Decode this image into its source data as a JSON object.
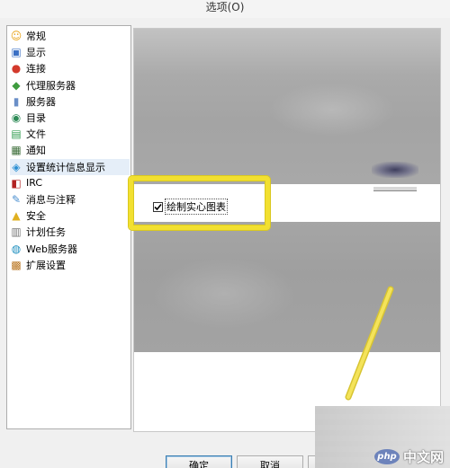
{
  "window": {
    "title": "选项(O)"
  },
  "sidebar": {
    "items": [
      {
        "label": "常规",
        "icon": "general-icon",
        "color": "#e8a317"
      },
      {
        "label": "显示",
        "icon": "display-icon",
        "color": "#3a6fc4"
      },
      {
        "label": "连接",
        "icon": "connection-icon",
        "color": "#d33a2c"
      },
      {
        "label": "代理服务器",
        "icon": "proxy-icon",
        "color": "#3f9c3f"
      },
      {
        "label": "服务器",
        "icon": "server-icon",
        "color": "#6a8fc7"
      },
      {
        "label": "目录",
        "icon": "directory-icon",
        "color": "#2e8b57"
      },
      {
        "label": "文件",
        "icon": "file-icon",
        "color": "#2f9b4e"
      },
      {
        "label": "通知",
        "icon": "notify-icon",
        "color": "#3d6e3a"
      },
      {
        "label": "设置统计信息显示",
        "icon": "statistics-icon",
        "color": "#2a8fd4",
        "selected": true
      },
      {
        "label": "IRC",
        "icon": "irc-icon",
        "color": "#b22222"
      },
      {
        "label": "消息与注释",
        "icon": "message-icon",
        "color": "#4a8fd0"
      },
      {
        "label": "安全",
        "icon": "security-icon",
        "color": "#e0b020"
      },
      {
        "label": "计划任务",
        "icon": "schedule-icon",
        "color": "#777777"
      },
      {
        "label": "Web服务器",
        "icon": "web-server-icon",
        "color": "#1f8fbf"
      },
      {
        "label": "扩展设置",
        "icon": "extension-icon",
        "color": "#b8731c"
      }
    ]
  },
  "content": {
    "checkbox": {
      "label": "绘制实心图表",
      "checked": true
    }
  },
  "buttons": {
    "ok": "确定",
    "cancel": "取消",
    "apply": ""
  },
  "watermark": {
    "logo": "php",
    "text": "中文网"
  },
  "colors": {
    "highlight": "#f2e030",
    "selection": "#e5eef8"
  }
}
